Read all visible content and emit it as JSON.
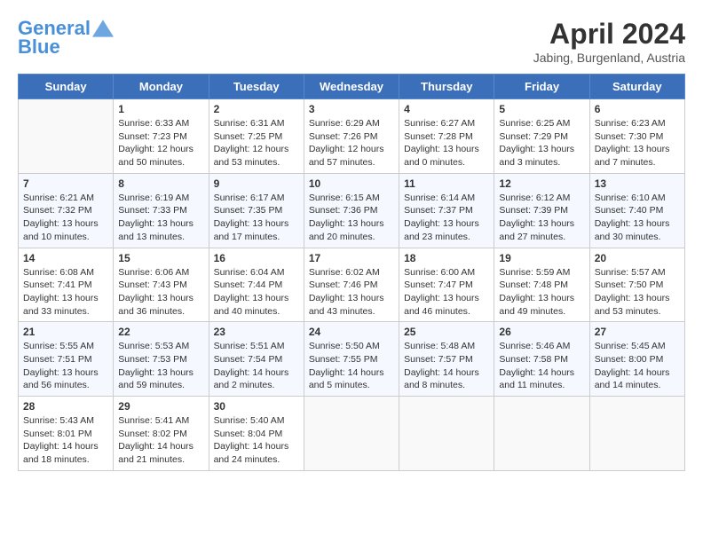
{
  "header": {
    "logo_line1": "General",
    "logo_line2": "Blue",
    "month": "April 2024",
    "location": "Jabing, Burgenland, Austria"
  },
  "days_of_week": [
    "Sunday",
    "Monday",
    "Tuesday",
    "Wednesday",
    "Thursday",
    "Friday",
    "Saturday"
  ],
  "weeks": [
    [
      {
        "day": "",
        "info": ""
      },
      {
        "day": "1",
        "sunrise": "6:33 AM",
        "sunset": "7:23 PM",
        "daylight": "12 hours and 50 minutes."
      },
      {
        "day": "2",
        "sunrise": "6:31 AM",
        "sunset": "7:25 PM",
        "daylight": "12 hours and 53 minutes."
      },
      {
        "day": "3",
        "sunrise": "6:29 AM",
        "sunset": "7:26 PM",
        "daylight": "12 hours and 57 minutes."
      },
      {
        "day": "4",
        "sunrise": "6:27 AM",
        "sunset": "7:28 PM",
        "daylight": "13 hours and 0 minutes."
      },
      {
        "day": "5",
        "sunrise": "6:25 AM",
        "sunset": "7:29 PM",
        "daylight": "13 hours and 3 minutes."
      },
      {
        "day": "6",
        "sunrise": "6:23 AM",
        "sunset": "7:30 PM",
        "daylight": "13 hours and 7 minutes."
      }
    ],
    [
      {
        "day": "7",
        "sunrise": "6:21 AM",
        "sunset": "7:32 PM",
        "daylight": "13 hours and 10 minutes."
      },
      {
        "day": "8",
        "sunrise": "6:19 AM",
        "sunset": "7:33 PM",
        "daylight": "13 hours and 13 minutes."
      },
      {
        "day": "9",
        "sunrise": "6:17 AM",
        "sunset": "7:35 PM",
        "daylight": "13 hours and 17 minutes."
      },
      {
        "day": "10",
        "sunrise": "6:15 AM",
        "sunset": "7:36 PM",
        "daylight": "13 hours and 20 minutes."
      },
      {
        "day": "11",
        "sunrise": "6:14 AM",
        "sunset": "7:37 PM",
        "daylight": "13 hours and 23 minutes."
      },
      {
        "day": "12",
        "sunrise": "6:12 AM",
        "sunset": "7:39 PM",
        "daylight": "13 hours and 27 minutes."
      },
      {
        "day": "13",
        "sunrise": "6:10 AM",
        "sunset": "7:40 PM",
        "daylight": "13 hours and 30 minutes."
      }
    ],
    [
      {
        "day": "14",
        "sunrise": "6:08 AM",
        "sunset": "7:41 PM",
        "daylight": "13 hours and 33 minutes."
      },
      {
        "day": "15",
        "sunrise": "6:06 AM",
        "sunset": "7:43 PM",
        "daylight": "13 hours and 36 minutes."
      },
      {
        "day": "16",
        "sunrise": "6:04 AM",
        "sunset": "7:44 PM",
        "daylight": "13 hours and 40 minutes."
      },
      {
        "day": "17",
        "sunrise": "6:02 AM",
        "sunset": "7:46 PM",
        "daylight": "13 hours and 43 minutes."
      },
      {
        "day": "18",
        "sunrise": "6:00 AM",
        "sunset": "7:47 PM",
        "daylight": "13 hours and 46 minutes."
      },
      {
        "day": "19",
        "sunrise": "5:59 AM",
        "sunset": "7:48 PM",
        "daylight": "13 hours and 49 minutes."
      },
      {
        "day": "20",
        "sunrise": "5:57 AM",
        "sunset": "7:50 PM",
        "daylight": "13 hours and 53 minutes."
      }
    ],
    [
      {
        "day": "21",
        "sunrise": "5:55 AM",
        "sunset": "7:51 PM",
        "daylight": "13 hours and 56 minutes."
      },
      {
        "day": "22",
        "sunrise": "5:53 AM",
        "sunset": "7:53 PM",
        "daylight": "13 hours and 59 minutes."
      },
      {
        "day": "23",
        "sunrise": "5:51 AM",
        "sunset": "7:54 PM",
        "daylight": "14 hours and 2 minutes."
      },
      {
        "day": "24",
        "sunrise": "5:50 AM",
        "sunset": "7:55 PM",
        "daylight": "14 hours and 5 minutes."
      },
      {
        "day": "25",
        "sunrise": "5:48 AM",
        "sunset": "7:57 PM",
        "daylight": "14 hours and 8 minutes."
      },
      {
        "day": "26",
        "sunrise": "5:46 AM",
        "sunset": "7:58 PM",
        "daylight": "14 hours and 11 minutes."
      },
      {
        "day": "27",
        "sunrise": "5:45 AM",
        "sunset": "8:00 PM",
        "daylight": "14 hours and 14 minutes."
      }
    ],
    [
      {
        "day": "28",
        "sunrise": "5:43 AM",
        "sunset": "8:01 PM",
        "daylight": "14 hours and 18 minutes."
      },
      {
        "day": "29",
        "sunrise": "5:41 AM",
        "sunset": "8:02 PM",
        "daylight": "14 hours and 21 minutes."
      },
      {
        "day": "30",
        "sunrise": "5:40 AM",
        "sunset": "8:04 PM",
        "daylight": "14 hours and 24 minutes."
      },
      {
        "day": "",
        "info": ""
      },
      {
        "day": "",
        "info": ""
      },
      {
        "day": "",
        "info": ""
      },
      {
        "day": "",
        "info": ""
      }
    ]
  ]
}
